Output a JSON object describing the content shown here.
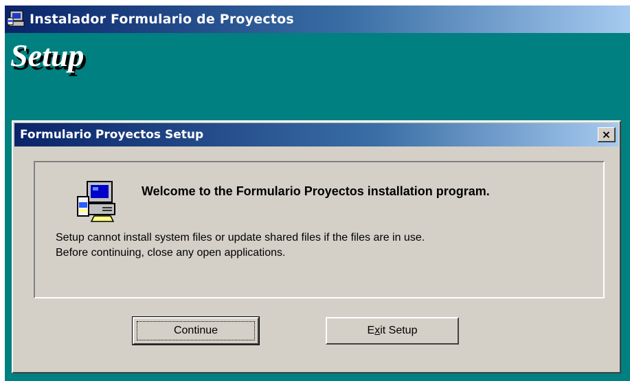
{
  "outer_window": {
    "title": "Instalador Formulario de Proyectos",
    "banner": "Setup",
    "background_color": "#008080"
  },
  "dialog": {
    "title": "Formulario Proyectos Setup",
    "close_label": "×",
    "heading": "Welcome to the Formulario Proyectos installation program.",
    "info_line1": "Setup cannot install system files or update shared files if the files are in use.",
    "info_line2": "Before continuing, close any open applications.",
    "buttons": {
      "continue_label": "Continue",
      "exit_label_pre": "E",
      "exit_label_accel": "x",
      "exit_label_post": "it Setup"
    }
  },
  "icons": {
    "window_icon": "computer-setup-icon",
    "setup_icon": "computer-setup-icon"
  },
  "colors": {
    "title_gradient_start": "#0a246a",
    "title_gradient_end": "#a6caf0",
    "dialog_face": "#d4d0c8"
  }
}
